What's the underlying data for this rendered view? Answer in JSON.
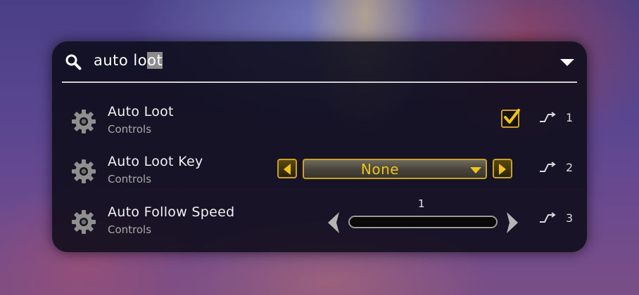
{
  "search": {
    "query_unselected": "auto lo",
    "query_selected": "ot"
  },
  "results": [
    {
      "title": "Auto Loot",
      "category": "Controls",
      "control": "checkbox",
      "checked": true,
      "binding_number": "1"
    },
    {
      "title": "Auto Loot Key",
      "category": "Controls",
      "control": "dropdown",
      "selected_value": "None",
      "binding_number": "2"
    },
    {
      "title": "Auto Follow Speed",
      "category": "Controls",
      "control": "slider",
      "slider_value": "1",
      "binding_number": "3"
    }
  ],
  "icons": {
    "search": "search-icon",
    "dropdown": "triangle-down-icon",
    "setting": "gear-icon",
    "binding": "keybind-icon",
    "checkmark": "check-icon"
  },
  "colors": {
    "accent_gold": "#c9a227",
    "value_yellow": "#f0c419",
    "panel_bg": "#0a0a16"
  }
}
